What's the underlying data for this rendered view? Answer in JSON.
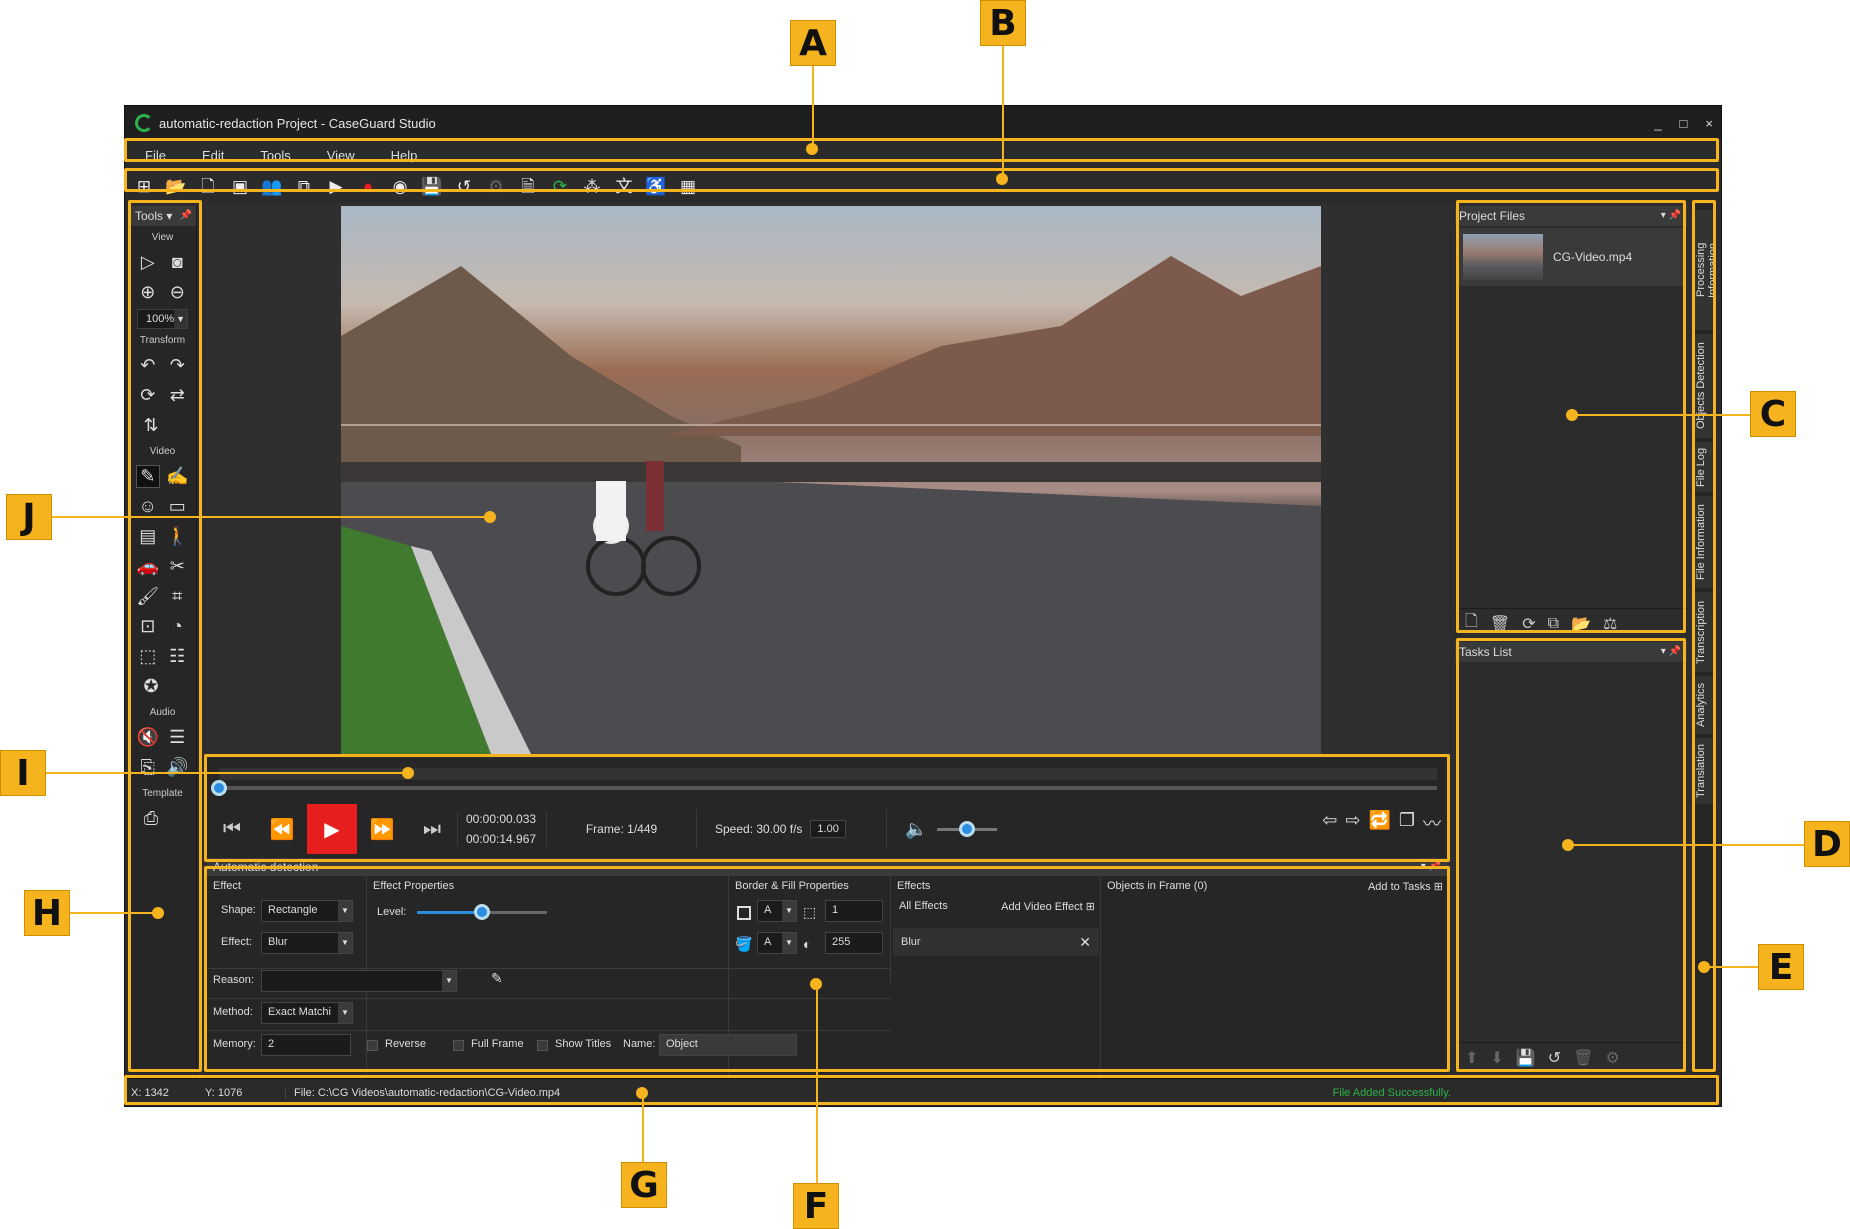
{
  "window": {
    "title": "automatic-redaction Project - CaseGuard Studio",
    "controls": [
      "_",
      "□",
      "×"
    ]
  },
  "menu": [
    "File",
    "Edit",
    "Tools",
    "View",
    "Help"
  ],
  "toolbar_icons": [
    "new-project-icon",
    "open-folder-icon",
    "new-file-icon",
    "media-icon",
    "people-icon",
    "copy-icon",
    "youtube-icon",
    "record-icon",
    "webcam-icon",
    "save-icon",
    "history-icon",
    "settings-icon",
    "document-icon",
    "refresh-icon",
    "nodes-icon",
    "translate-icon",
    "accessibility-icon",
    "calendar-icon"
  ],
  "tools": {
    "header": "Tools",
    "groups": {
      "view": "View",
      "transform": "Transform",
      "video": "Video",
      "audio": "Audio",
      "template": "Template"
    },
    "zoom": "100%"
  },
  "timeline": {
    "time_current": "00:00:00.033",
    "time_total": "00:00:14.967",
    "frame": "Frame: 1/449",
    "speed": "Speed: 30.00 f/s",
    "speed_value": "1.00",
    "progress": 0,
    "volume": 0.5
  },
  "detection": {
    "title": "Automatic detection",
    "effect_header": "Effect",
    "effect_props_header": "Effect Properties",
    "border_header": "Border & Fill Properties",
    "effects_header": "Effects",
    "objects_header": "Objects in Frame (0)",
    "add_to_tasks": "Add to Tasks",
    "shape_label": "Shape:",
    "shape_value": "Rectangle",
    "effect_label": "Effect:",
    "effect_value": "Blur",
    "level_label": "Level:",
    "level": 0.5,
    "border_width": "1",
    "fill_value": "255",
    "all_effects": "All Effects",
    "add_video_effect": "Add Video Effect",
    "effect_item": "Blur",
    "reason_label": "Reason:",
    "method_label": "Method:",
    "method_value": "Exact Matchi",
    "memory_label": "Memory:",
    "memory_value": "2",
    "reverse": "Reverse",
    "full_frame": "Full Frame",
    "show_titles": "Show Titles",
    "name_label": "Name:",
    "name_value": "Object"
  },
  "project_files": {
    "title": "Project Files",
    "file": "CG-Video.mp4"
  },
  "tasks": {
    "title": "Tasks List"
  },
  "side_tabs": [
    "Processing Information",
    "Objects Detection",
    "File Log",
    "File Information",
    "Transcription",
    "Analytics",
    "Translation"
  ],
  "status": {
    "x": "X:   1342",
    "y": "Y:   1076",
    "file": "File: C:\\CG Videos\\automatic-redaction\\CG-Video.mp4",
    "message": "File Added Successfully."
  },
  "annotations": [
    "A",
    "B",
    "C",
    "D",
    "E",
    "F",
    "G",
    "H",
    "I",
    "J"
  ],
  "colors": {
    "accent": "#f5b41e",
    "play": "#e61e1e",
    "success": "#2fb24a",
    "knob": "#2b8de0"
  }
}
